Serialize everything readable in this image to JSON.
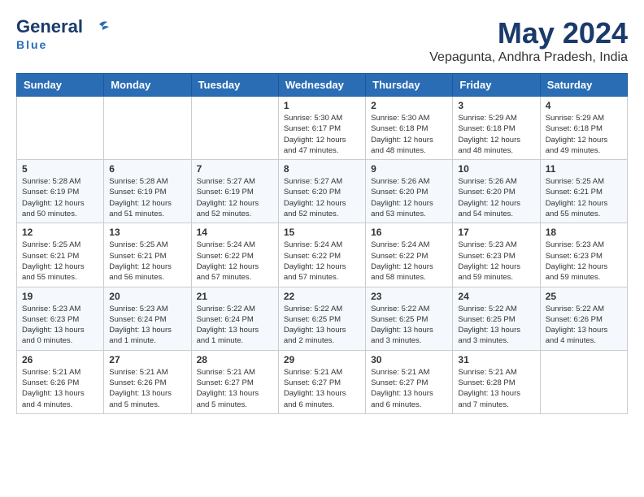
{
  "header": {
    "logo_general": "General",
    "logo_blue": "Blue",
    "month": "May 2024",
    "location": "Vepagunta, Andhra Pradesh, India"
  },
  "columns": [
    "Sunday",
    "Monday",
    "Tuesday",
    "Wednesday",
    "Thursday",
    "Friday",
    "Saturday"
  ],
  "weeks": [
    [
      {
        "day": "",
        "info": ""
      },
      {
        "day": "",
        "info": ""
      },
      {
        "day": "",
        "info": ""
      },
      {
        "day": "1",
        "info": "Sunrise: 5:30 AM\nSunset: 6:17 PM\nDaylight: 12 hours\nand 47 minutes."
      },
      {
        "day": "2",
        "info": "Sunrise: 5:30 AM\nSunset: 6:18 PM\nDaylight: 12 hours\nand 48 minutes."
      },
      {
        "day": "3",
        "info": "Sunrise: 5:29 AM\nSunset: 6:18 PM\nDaylight: 12 hours\nand 48 minutes."
      },
      {
        "day": "4",
        "info": "Sunrise: 5:29 AM\nSunset: 6:18 PM\nDaylight: 12 hours\nand 49 minutes."
      }
    ],
    [
      {
        "day": "5",
        "info": "Sunrise: 5:28 AM\nSunset: 6:19 PM\nDaylight: 12 hours\nand 50 minutes."
      },
      {
        "day": "6",
        "info": "Sunrise: 5:28 AM\nSunset: 6:19 PM\nDaylight: 12 hours\nand 51 minutes."
      },
      {
        "day": "7",
        "info": "Sunrise: 5:27 AM\nSunset: 6:19 PM\nDaylight: 12 hours\nand 52 minutes."
      },
      {
        "day": "8",
        "info": "Sunrise: 5:27 AM\nSunset: 6:20 PM\nDaylight: 12 hours\nand 52 minutes."
      },
      {
        "day": "9",
        "info": "Sunrise: 5:26 AM\nSunset: 6:20 PM\nDaylight: 12 hours\nand 53 minutes."
      },
      {
        "day": "10",
        "info": "Sunrise: 5:26 AM\nSunset: 6:20 PM\nDaylight: 12 hours\nand 54 minutes."
      },
      {
        "day": "11",
        "info": "Sunrise: 5:25 AM\nSunset: 6:21 PM\nDaylight: 12 hours\nand 55 minutes."
      }
    ],
    [
      {
        "day": "12",
        "info": "Sunrise: 5:25 AM\nSunset: 6:21 PM\nDaylight: 12 hours\nand 55 minutes."
      },
      {
        "day": "13",
        "info": "Sunrise: 5:25 AM\nSunset: 6:21 PM\nDaylight: 12 hours\nand 56 minutes."
      },
      {
        "day": "14",
        "info": "Sunrise: 5:24 AM\nSunset: 6:22 PM\nDaylight: 12 hours\nand 57 minutes."
      },
      {
        "day": "15",
        "info": "Sunrise: 5:24 AM\nSunset: 6:22 PM\nDaylight: 12 hours\nand 57 minutes."
      },
      {
        "day": "16",
        "info": "Sunrise: 5:24 AM\nSunset: 6:22 PM\nDaylight: 12 hours\nand 58 minutes."
      },
      {
        "day": "17",
        "info": "Sunrise: 5:23 AM\nSunset: 6:23 PM\nDaylight: 12 hours\nand 59 minutes."
      },
      {
        "day": "18",
        "info": "Sunrise: 5:23 AM\nSunset: 6:23 PM\nDaylight: 12 hours\nand 59 minutes."
      }
    ],
    [
      {
        "day": "19",
        "info": "Sunrise: 5:23 AM\nSunset: 6:23 PM\nDaylight: 13 hours\nand 0 minutes."
      },
      {
        "day": "20",
        "info": "Sunrise: 5:23 AM\nSunset: 6:24 PM\nDaylight: 13 hours\nand 1 minute."
      },
      {
        "day": "21",
        "info": "Sunrise: 5:22 AM\nSunset: 6:24 PM\nDaylight: 13 hours\nand 1 minute."
      },
      {
        "day": "22",
        "info": "Sunrise: 5:22 AM\nSunset: 6:25 PM\nDaylight: 13 hours\nand 2 minutes."
      },
      {
        "day": "23",
        "info": "Sunrise: 5:22 AM\nSunset: 6:25 PM\nDaylight: 13 hours\nand 3 minutes."
      },
      {
        "day": "24",
        "info": "Sunrise: 5:22 AM\nSunset: 6:25 PM\nDaylight: 13 hours\nand 3 minutes."
      },
      {
        "day": "25",
        "info": "Sunrise: 5:22 AM\nSunset: 6:26 PM\nDaylight: 13 hours\nand 4 minutes."
      }
    ],
    [
      {
        "day": "26",
        "info": "Sunrise: 5:21 AM\nSunset: 6:26 PM\nDaylight: 13 hours\nand 4 minutes."
      },
      {
        "day": "27",
        "info": "Sunrise: 5:21 AM\nSunset: 6:26 PM\nDaylight: 13 hours\nand 5 minutes."
      },
      {
        "day": "28",
        "info": "Sunrise: 5:21 AM\nSunset: 6:27 PM\nDaylight: 13 hours\nand 5 minutes."
      },
      {
        "day": "29",
        "info": "Sunrise: 5:21 AM\nSunset: 6:27 PM\nDaylight: 13 hours\nand 6 minutes."
      },
      {
        "day": "30",
        "info": "Sunrise: 5:21 AM\nSunset: 6:27 PM\nDaylight: 13 hours\nand 6 minutes."
      },
      {
        "day": "31",
        "info": "Sunrise: 5:21 AM\nSunset: 6:28 PM\nDaylight: 13 hours\nand 7 minutes."
      },
      {
        "day": "",
        "info": ""
      }
    ]
  ]
}
